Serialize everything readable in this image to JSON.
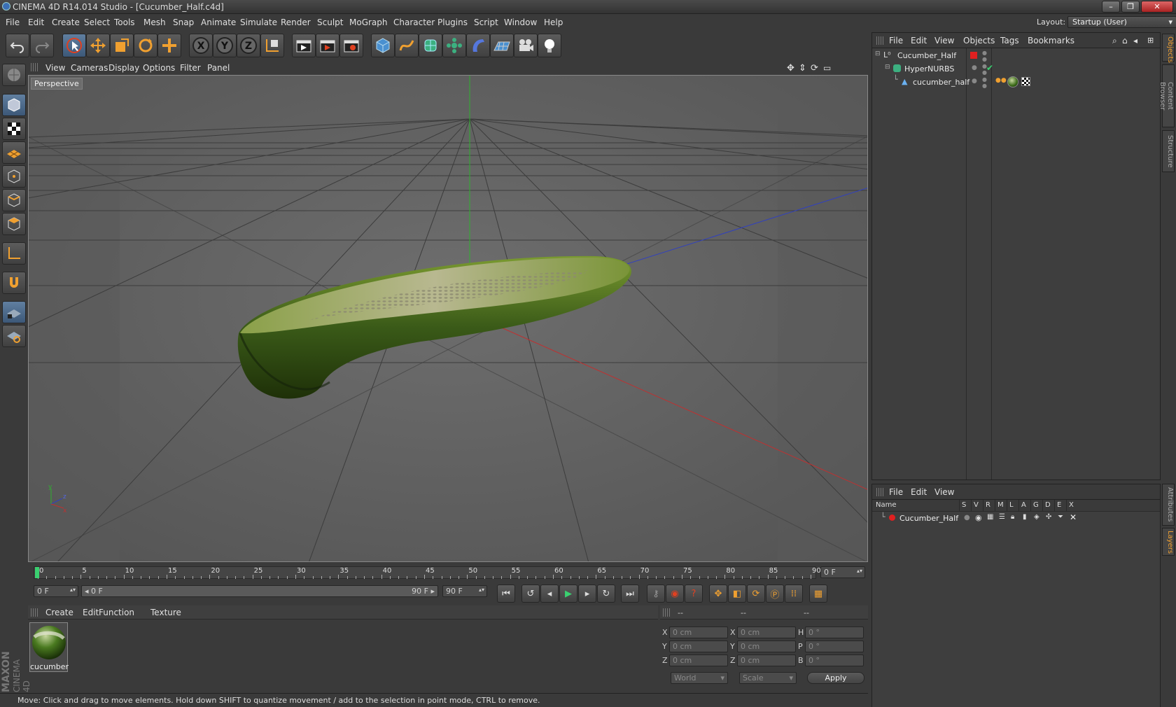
{
  "window": {
    "title": "CINEMA 4D R14.014 Studio - [Cucumber_Half.c4d]",
    "buttons": {
      "minimize": "–",
      "maximize": "❐",
      "close": "✕"
    }
  },
  "menubar": {
    "items": [
      "File",
      "Edit",
      "Create",
      "Select",
      "Tools",
      "Mesh",
      "Snap",
      "Animate",
      "Simulate",
      "Render",
      "Sculpt",
      "MoGraph",
      "Character",
      "Plugins",
      "Script",
      "Window",
      "Help"
    ],
    "layout_label": "Layout:",
    "layout_value": "Startup (User)"
  },
  "toolbar": {
    "icons": [
      "undo-icon",
      "redo-icon",
      "live-selection-icon",
      "move-icon",
      "scale-icon",
      "rotate-icon",
      "add-icon",
      "x-axis-icon",
      "y-axis-icon",
      "z-axis-icon",
      "coordinate-system-icon",
      "render-view-icon",
      "render-picture-viewer-icon",
      "render-settings-icon",
      "cube-icon",
      "spline-pen-icon",
      "subdivision-surface-icon",
      "cloner-icon",
      "deformer-icon",
      "floor-icon",
      "camera-icon",
      "light-icon"
    ],
    "axis_labels": {
      "x": "X",
      "y": "Y",
      "z": "Z"
    }
  },
  "viewport": {
    "menu": [
      "View",
      "Cameras",
      "Display",
      "Options",
      "Filter",
      "Panel"
    ],
    "label": "Perspective",
    "axis_labels": {
      "x": "x",
      "y": "y",
      "z": "z"
    }
  },
  "timeline": {
    "ticks": [
      "0",
      "5",
      "10",
      "15",
      "20",
      "25",
      "30",
      "35",
      "40",
      "45",
      "50",
      "55",
      "60",
      "65",
      "70",
      "75",
      "80",
      "85",
      "90"
    ],
    "current_frame": "0 F",
    "start_field": "0 F",
    "range_start": "0 F",
    "range_end": "90 F",
    "end_field": "90 F",
    "playhead_fraction": 0
  },
  "material_panel": {
    "menu": [
      "Create",
      "Edit",
      "Function",
      "Texture"
    ],
    "material_name": "cucumber",
    "brand": "MAXON",
    "brand_sub": "CINEMA 4D"
  },
  "coord_panel": {
    "header": [
      "--",
      "--",
      "--"
    ],
    "rows": [
      {
        "pos_label": "X",
        "pos": "0 cm",
        "size_label": "X",
        "size": "0 cm",
        "rot_label": "H",
        "rot": "0 °"
      },
      {
        "pos_label": "Y",
        "pos": "0 cm",
        "size_label": "Y",
        "size": "0 cm",
        "rot_label": "P",
        "rot": "0 °"
      },
      {
        "pos_label": "Z",
        "pos": "0 cm",
        "size_label": "Z",
        "size": "0 cm",
        "rot_label": "B",
        "rot": "0 °"
      }
    ],
    "mode": "World",
    "size_mode": "Scale",
    "apply": "Apply"
  },
  "object_manager": {
    "menu": [
      "File",
      "Edit",
      "View",
      "Objects",
      "Tags",
      "Bookmarks"
    ],
    "objects": [
      {
        "name": "Cucumber_Half",
        "indent": 0
      },
      {
        "name": "HyperNURBS",
        "indent": 1
      },
      {
        "name": "cucumber_half",
        "indent": 2
      }
    ]
  },
  "layer_manager": {
    "menu": [
      "File",
      "Edit",
      "View"
    ],
    "columns": [
      "Name",
      "S",
      "V",
      "R",
      "M",
      "L",
      "A",
      "G",
      "D",
      "E",
      "X"
    ],
    "layers": [
      {
        "name": "Cucumber_Half",
        "color": "#e02020"
      }
    ]
  },
  "right_dock_tabs": [
    "Objects",
    "Content Browser",
    "Structure",
    "Attributes",
    "Layers"
  ],
  "status": "Move: Click and drag to move elements. Hold down SHIFT to quantize movement / add to the selection in point mode, CTRL to remove.",
  "colors": {
    "accent": "#f0a030",
    "x_axis": "#c03030",
    "y_axis": "#30b030",
    "z_axis": "#3040c0",
    "layer_red": "#e02020"
  }
}
